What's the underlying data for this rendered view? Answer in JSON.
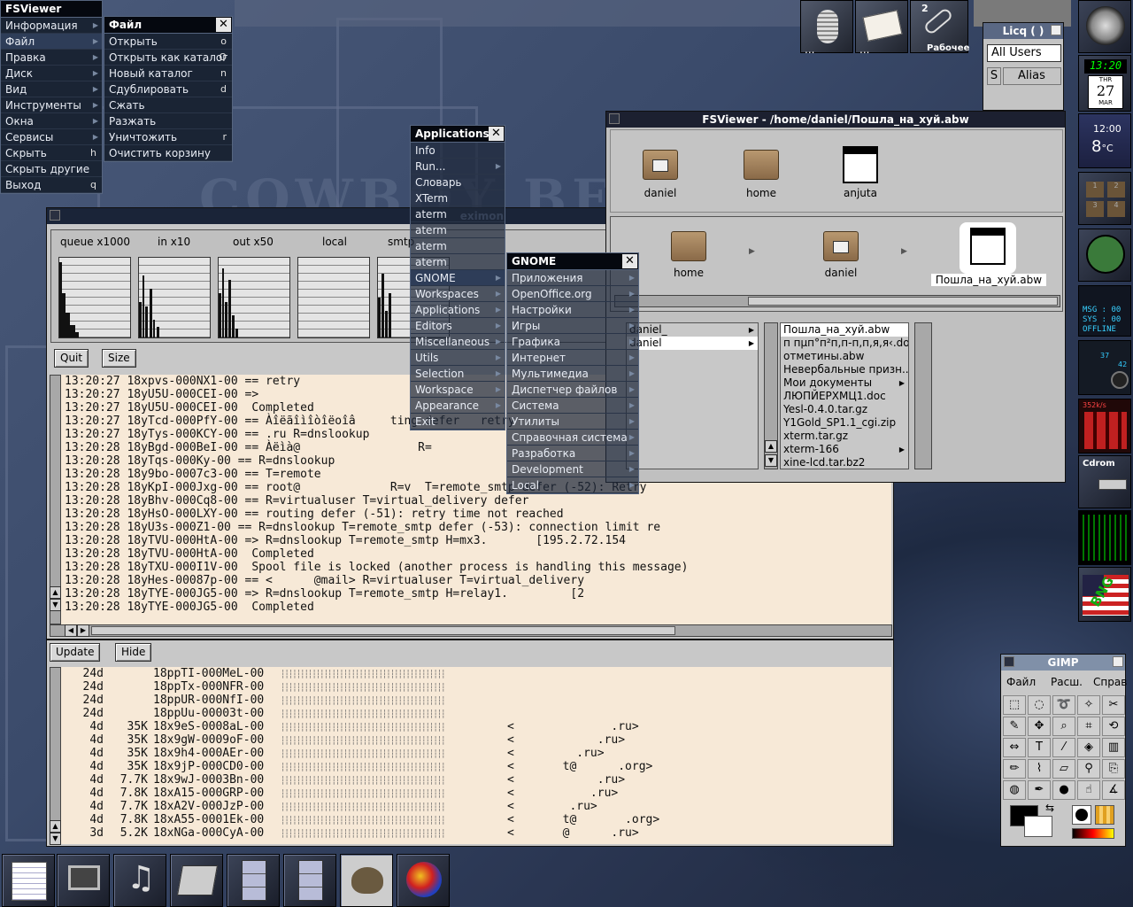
{
  "app_menu": {
    "title": "FSViewer",
    "items": [
      {
        "label": "Информация",
        "key": ""
      },
      {
        "label": "Файл",
        "key": ""
      },
      {
        "label": "Правка",
        "key": ""
      },
      {
        "label": "Диск",
        "key": ""
      },
      {
        "label": "Вид",
        "key": ""
      },
      {
        "label": "Инструменты",
        "key": ""
      },
      {
        "label": "Окна",
        "key": ""
      },
      {
        "label": "Сервисы",
        "key": ""
      },
      {
        "label": "Скрыть",
        "key": "h"
      },
      {
        "label": "Скрыть другие",
        "key": ""
      },
      {
        "label": "Выход",
        "key": "q"
      }
    ]
  },
  "file_menu": {
    "title": "Файл",
    "close": "✕",
    "items": [
      {
        "label": "Открыть",
        "key": "o"
      },
      {
        "label": "Открыть как каталог",
        "key": "O"
      },
      {
        "label": "Новый каталог",
        "key": "n"
      },
      {
        "label": "Сдублировать",
        "key": "d"
      },
      {
        "label": "Сжать",
        "key": ""
      },
      {
        "label": "Разжать",
        "key": ""
      },
      {
        "label": "Уничтожить",
        "key": "r"
      },
      {
        "label": "Очистить корзину",
        "key": ""
      }
    ]
  },
  "apps_menu": {
    "title": "Applications",
    "close": "✕",
    "items": [
      "Info",
      "Run...",
      "Словарь",
      "XTerm",
      "aterm",
      "aterm",
      "aterm",
      "aterm",
      "GNOME",
      "Workspaces",
      "Applications",
      "Editors",
      "Miscellaneous",
      "Utils",
      "Selection",
      "Workspace",
      "Appearance",
      "Exit"
    ]
  },
  "gnome_menu": {
    "title": "GNOME",
    "close": "✕",
    "items": [
      "Приложения",
      "OpenOffice.org",
      "Настройки",
      "Игры",
      "Графика",
      "Интернет",
      "Мультимедиа",
      "Диспетчер файлов",
      "Система",
      "Утилиты",
      "Справочная система",
      "Разработка",
      "Development",
      "Local"
    ]
  },
  "eximon": {
    "title": "eximon",
    "graphs": [
      "queue x1000",
      "in x10",
      "out x50",
      "local",
      "smtp"
    ],
    "buttons": {
      "quit": "Quit",
      "size": "Size",
      "update": "Update",
      "hide": "Hide"
    },
    "log": [
      {
        "t": "13:20:27",
        "id": "18xpvs-000NX1-00",
        "op": "==",
        "rest": "retry"
      },
      {
        "t": "13:20:27",
        "id": "18yU5U-000CEI-00",
        "op": "=>",
        "rest": ""
      },
      {
        "t": "13:20:27",
        "id": "18yU5U-000CEI-00",
        "op": "",
        "rest": "Completed"
      },
      {
        "t": "13:20:27",
        "id": "18yTcd-000PfY-00",
        "op": "==",
        "rest": "Àîëãîìîòîëoîâ     ting defer   retry"
      },
      {
        "t": "13:20:27",
        "id": "18yTys-000KCY-00",
        "op": "==",
        "rest": ".ru R=dnslookup"
      },
      {
        "t": "13:20:28",
        "id": "18yBgd-000BeI-00",
        "op": "==",
        "rest": "Àëìà@                 R="
      },
      {
        "t": "13:20:28",
        "id": "18yTqs-000Ky-00",
        "op": "==",
        "rest": "R=dnslookup"
      },
      {
        "t": "13:20:28",
        "id": "18y9bo-0007c3-00",
        "op": "==",
        "rest": "T=remote"
      },
      {
        "t": "13:20:28",
        "id": "18yKpI-000Jxg-00",
        "op": "==",
        "rest": "root@             R=v  T=remote_smtp defer (-52): Retry"
      },
      {
        "t": "13:20:28",
        "id": "18yBhv-000Cq8-00",
        "op": "==",
        "rest": "R=virtualuser T=virtual_delivery defer"
      },
      {
        "t": "13:20:28",
        "id": "18yHsO-000LXY-00",
        "op": "==",
        "rest": "routing defer (-51): retry time not reached"
      },
      {
        "t": "13:20:28",
        "id": "18yU3s-000Z1-00",
        "op": "==",
        "rest": "R=dnslookup T=remote_smtp defer (-53): connection limit re"
      },
      {
        "t": "13:20:28",
        "id": "18yTVU-000HtA-00",
        "op": "=>",
        "rest": "R=dnslookup T=remote_smtp H=mx3.       [195.2.72.154"
      },
      {
        "t": "13:20:28",
        "id": "18yTVU-000HtA-00",
        "op": "",
        "rest": "Completed"
      },
      {
        "t": "13:20:28",
        "id": "18yTXU-000I1V-00",
        "op": "",
        "rest": "Spool file is locked (another process is handling this message)"
      },
      {
        "t": "13:20:28",
        "id": "18yHes-00087p-00",
        "op": "==",
        "rest": "<      @mail> R=virtualuser T=virtual_delivery"
      },
      {
        "t": "13:20:28",
        "id": "18yTYE-000JG5-00",
        "op": "=>",
        "rest": "R=dnslookup T=remote_smtp H=relay1.         [2"
      },
      {
        "t": "13:20:28",
        "id": "18yTYE-000JG5-00",
        "op": "",
        "rest": "Completed"
      }
    ],
    "queue": [
      {
        "age": "24d",
        "size": "",
        "id": "18ppTI-000MeL-00",
        "addr": ""
      },
      {
        "age": "24d",
        "size": "",
        "id": "18ppTx-000NFR-00",
        "addr": ""
      },
      {
        "age": "24d",
        "size": "",
        "id": "18ppUR-000NfI-00",
        "addr": ""
      },
      {
        "age": "24d",
        "size": "",
        "id": "18ppUu-00003t-00",
        "addr": ""
      },
      {
        "age": "4d",
        "size": "35K",
        "id": "18x9eS-0008aL-00",
        "addr": "<              .ru>"
      },
      {
        "age": "4d",
        "size": "35K",
        "id": "18x9gW-0009oF-00",
        "addr": "<            .ru>"
      },
      {
        "age": "4d",
        "size": "35K",
        "id": "18x9h4-000AEr-00",
        "addr": "<         .ru>"
      },
      {
        "age": "4d",
        "size": "35K",
        "id": "18x9jP-000CD0-00",
        "addr": "<       t@      .org>"
      },
      {
        "age": "4d",
        "size": "7.7K",
        "id": "18x9wJ-0003Bn-00",
        "addr": "<            .ru>"
      },
      {
        "age": "4d",
        "size": "7.8K",
        "id": "18xA15-000GRP-00",
        "addr": "<           .ru>"
      },
      {
        "age": "4d",
        "size": "7.7K",
        "id": "18xA2V-000JzP-00",
        "addr": "<        .ru>"
      },
      {
        "age": "4d",
        "size": "7.8K",
        "id": "18xA55-0001Ek-00",
        "addr": "<       t@       .org>"
      },
      {
        "age": "3d",
        "size": "5.2K",
        "id": "18xNGa-000CyA-00",
        "addr": "<       @      .ru>"
      }
    ]
  },
  "fsviewer": {
    "title": "FSViewer - /home/daniel/Пошла_на_хуй.abw",
    "shelf": [
      {
        "label": "daniel",
        "type": "home-folder"
      },
      {
        "label": "home",
        "type": "folder"
      },
      {
        "label": "anjuta",
        "type": "doc"
      }
    ],
    "path": [
      {
        "label": "home",
        "type": "folder"
      },
      {
        "label": "daniel",
        "type": "home-folder"
      },
      {
        "label": "Пошла_на_хуй.abw",
        "type": "doc"
      }
    ],
    "col1": [
      "daniel_",
      "daniel"
    ],
    "col2": [
      "Пошла_на_хуй.abw",
      "п пµп°п²п,п-п,п,я,я‹.doc",
      "отметины.abw",
      "Невербальные призн...",
      "Мои документы",
      "ЛЮПЙЕРХМЦ1.doc",
      "Yesl-0.4.0.tar.gz",
      "Y1Gold_SP1.1_cgi.zip",
      "xterm.tar.gz",
      "xterm-166",
      "xine-lcd.tar.bz2"
    ]
  },
  "licq": {
    "title": "Licq ( )",
    "group": "All Users",
    "col_s": "S",
    "col_alias": "Alias"
  },
  "gimp": {
    "title": "GIMP",
    "menu": [
      "Файл",
      "Расш.",
      "Справ"
    ]
  },
  "dock": {
    "clock_time": "13:20",
    "clock_day": "THR",
    "clock_date": "27",
    "clock_month": "MAR",
    "weather_time": "12:00",
    "weather_temp": "8",
    "weather_unit": "°C",
    "msg": "MSG : 00",
    "sys": "SYS : 00",
    "status": "OFFLINE",
    "cdrom": "Cdrom",
    "workspace_num": "2",
    "workspace_label": "Рабочее",
    "net_label": "352k/s",
    "desk1": "1",
    "desk2": "2",
    "desk3": "3",
    "desk4": "4",
    "vol": "37",
    "vol2": "42",
    "bng": "BNG"
  }
}
